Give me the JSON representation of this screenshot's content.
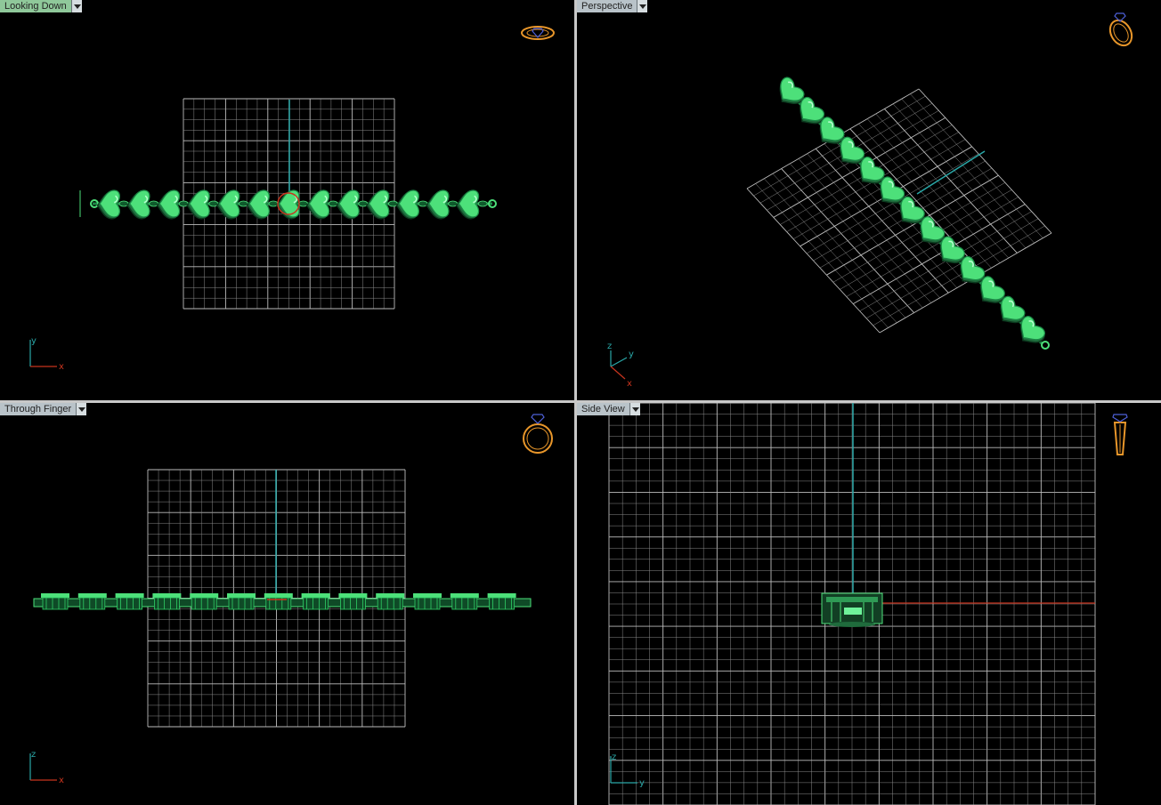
{
  "viewports": {
    "top_left": {
      "label": "Looking Down",
      "active": true
    },
    "top_right": {
      "label": "Perspective",
      "active": false
    },
    "bottom_left": {
      "label": "Through Finger",
      "active": false
    },
    "bottom_right": {
      "label": "Side View",
      "active": false
    }
  },
  "axes": {
    "top_left": {
      "a": "y",
      "b": "x"
    },
    "top_right": {
      "a": "z",
      "b": "y",
      "c": "x"
    },
    "bottom_left": {
      "a": "z",
      "b": "x"
    },
    "bottom_right": {
      "a": "z",
      "b": "y"
    }
  },
  "icons": {
    "top_left": "ring-top-icon",
    "top_right": "ring-perspective-icon",
    "bottom_left": "ring-front-icon",
    "bottom_right": "ring-side-icon"
  },
  "colors": {
    "grid": "#8a8a8a",
    "grid_major": "#bdbdbd",
    "axis_teal": "#2aa8a8",
    "axis_red": "#c8341e",
    "model_green": "#4de07a",
    "model_dark": "#1f6b3c",
    "gizmo_orange": "#e8962a",
    "gizmo_blue": "#4d5fd6",
    "tab_active": "#8fc89a",
    "tab": "#b9c3c9"
  }
}
